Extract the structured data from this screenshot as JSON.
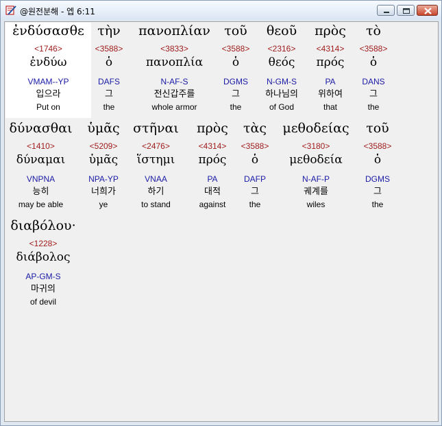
{
  "window": {
    "title": "@원전분해 - 엡 6:11",
    "buttons": {
      "minimize": "minimize",
      "maximize": "maximize",
      "close": "close"
    }
  },
  "words": [
    {
      "greek": "ἐνδύσασθε",
      "strong": "<1746>",
      "lemma": "ἐνδύω",
      "parse": "VMAM--YP",
      "korean": "입으라",
      "english": "Put on"
    },
    {
      "greek": "τὴν",
      "strong": "<3588>",
      "lemma": "ὁ",
      "parse": "DAFS",
      "korean": "그",
      "english": "the"
    },
    {
      "greek": "πανοπλίαν",
      "strong": "<3833>",
      "lemma": "πανοπλία",
      "parse": "N-AF-S",
      "korean": "전신갑주를",
      "english": "whole armor"
    },
    {
      "greek": "τοῦ",
      "strong": "<3588>",
      "lemma": "ὁ",
      "parse": "DGMS",
      "korean": "그",
      "english": "the"
    },
    {
      "greek": "θεοῦ",
      "strong": "<2316>",
      "lemma": "θεός",
      "parse": "N-GM-S",
      "korean": "하나님의",
      "english": "of God"
    },
    {
      "greek": "πρὸς",
      "strong": "<4314>",
      "lemma": "πρός",
      "parse": "PA",
      "korean": "위하여",
      "english": "that"
    },
    {
      "greek": "τὸ",
      "strong": "<3588>",
      "lemma": "ὁ",
      "parse": "DANS",
      "korean": "그",
      "english": "the"
    },
    {
      "greek": "δύνασθαι",
      "strong": "<1410>",
      "lemma": "δύναμαι",
      "parse": "VNPNA",
      "korean": "능히",
      "english": "may be able"
    },
    {
      "greek": "ὑμᾶς",
      "strong": "<5209>",
      "lemma": "ὑμᾶς",
      "parse": "NPA-YP",
      "korean": "너희가",
      "english": "ye"
    },
    {
      "greek": "στῆναι",
      "strong": "<2476>",
      "lemma": "ἵστημι",
      "parse": "VNAA",
      "korean": "하기",
      "english": "to stand"
    },
    {
      "greek": "πρὸς",
      "strong": "<4314>",
      "lemma": "πρός",
      "parse": "PA",
      "korean": "대적",
      "english": "against"
    },
    {
      "greek": "τὰς",
      "strong": "<3588>",
      "lemma": "ὁ",
      "parse": "DAFP",
      "korean": "그",
      "english": "the"
    },
    {
      "greek": "μεθοδείας",
      "strong": "<3180>",
      "lemma": "μεθοδεία",
      "parse": "N-AF-P",
      "korean": "궤계를",
      "english": "wiles"
    },
    {
      "greek": "τοῦ",
      "strong": "<3588>",
      "lemma": "ὁ",
      "parse": "DGMS",
      "korean": "그",
      "english": "the"
    },
    {
      "greek": "διαβόλου·",
      "strong": "<1228>",
      "lemma": "διάβολος",
      "parse": "AP-GM-S",
      "korean": "마귀의",
      "english": "of devil"
    }
  ],
  "colors": {
    "strong": "#a01c1c",
    "parse": "#1a1aa6",
    "highlight": "#ffffff"
  },
  "icons": {
    "app": "book-pencil-icon"
  }
}
